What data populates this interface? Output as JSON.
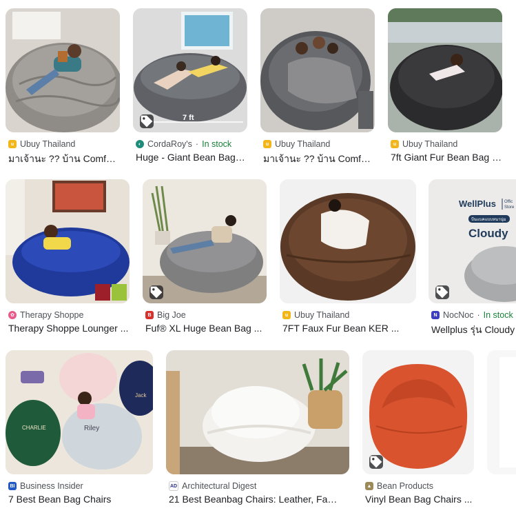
{
  "cards": [
    {
      "source": "Ubuy Thailand",
      "title": "มาเจ้านะ ?? บ้าน Comfy Sack ที่...",
      "stock": ""
    },
    {
      "source": "CordaRoy's",
      "title": "Huge - Giant Bean Bag Bed ...",
      "stock": "In stock",
      "ruler": "7 ft"
    },
    {
      "source": "Ubuy Thailand",
      "title": "มาเจ้านะ ?? บ้าน Comfy Sack ที่...",
      "stock": ""
    },
    {
      "source": "Ubuy Thailand",
      "title": "7ft Giant Fur Bean Bag Cover ...",
      "stock": ""
    },
    {
      "source": "Therapy Shoppe",
      "title": "Therapy Shoppe Lounger ...",
      "stock": ""
    },
    {
      "source": "Big Joe",
      "title": "Fuf® XL Huge Bean Bag ...",
      "stock": ""
    },
    {
      "source": "Ubuy Thailand",
      "title": "7FT Faux Fur Bean KER ...",
      "stock": ""
    },
    {
      "source": "NocNoc",
      "title": "Wellplus รุ่น Cloudy ...",
      "stock": "In stock",
      "brand": "WellPlus",
      "brand_sub1": "Offic",
      "brand_sub2": "Store",
      "badge": "บีนแบคแบบหนานุ่ม",
      "product": "Cloudy"
    },
    {
      "source": "Business Insider",
      "title": "7 Best Bean Bag Chairs",
      "stock": "",
      "labels": [
        "CHARLIE",
        "Riley",
        "Jack"
      ]
    },
    {
      "source": "Architectural Digest",
      "title": "21 Best Beanbag Chairs: Leather, Fabric ...",
      "stock": ""
    },
    {
      "source": "Bean Products",
      "title": "Vinyl Bean Bag Chairs ...",
      "stock": ""
    }
  ],
  "separator": "·",
  "icons": {
    "tag": "shopping-tag-icon"
  }
}
